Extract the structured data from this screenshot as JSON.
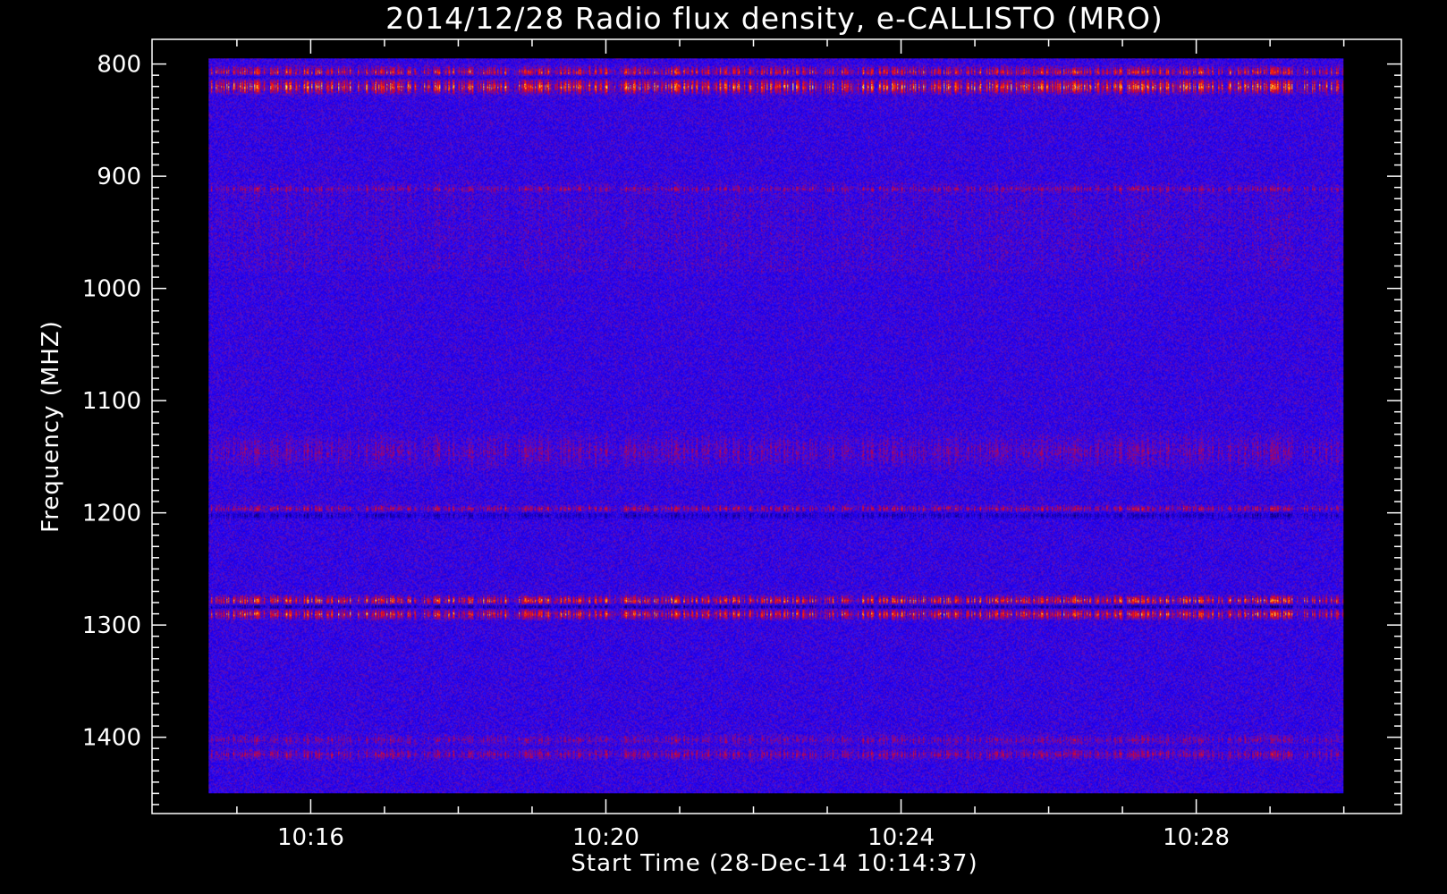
{
  "chart_data": {
    "type": "heatmap",
    "title": "2014/12/28  Radio flux density, e-CALLISTO (MRO)",
    "xlabel": "Start Time (28-Dec-14 10:14:37)",
    "ylabel": "Frequency (MHZ)",
    "x_ticks": [
      "10:16",
      "10:20",
      "10:24",
      "10:28"
    ],
    "x_tick_minutes": [
      16,
      20,
      24,
      28
    ],
    "x_range_minutes": [
      14.617,
      30.0
    ],
    "xlim_minutes": [
      13.85,
      30.78
    ],
    "y_ticks": [
      800,
      900,
      1000,
      1100,
      1200,
      1300,
      1400
    ],
    "y_range_mhz": [
      795,
      1450
    ],
    "ylim_mhz": [
      778,
      1468
    ],
    "y_inverted": true,
    "grid": false,
    "colormap": [
      "#000000",
      "#1a00c8",
      "#2020ff",
      "#a01030",
      "#ff2000",
      "#ff9000",
      "#ffff60"
    ],
    "background_color": "#2424ff",
    "emission_bands": [
      {
        "center_mhz": 808,
        "width_mhz": 8,
        "intensity": 0.8,
        "note": "red/orange band"
      },
      {
        "center_mhz": 820,
        "width_mhz": 8,
        "intensity": 0.95,
        "note": "yellow band"
      },
      {
        "center_mhz": 811,
        "width_mhz": 4,
        "intensity": -0.7,
        "note": "dark band"
      },
      {
        "center_mhz": 911,
        "width_mhz": 3,
        "intensity": 0.35
      },
      {
        "center_mhz": 1145,
        "width_mhz": 20,
        "intensity": 0.25
      },
      {
        "center_mhz": 1196,
        "width_mhz": 4,
        "intensity": 0.5
      },
      {
        "center_mhz": 1202,
        "width_mhz": 4,
        "intensity": -0.5
      },
      {
        "center_mhz": 1278,
        "width_mhz": 6,
        "intensity": 0.85
      },
      {
        "center_mhz": 1283,
        "width_mhz": 3,
        "intensity": -0.8
      },
      {
        "center_mhz": 1290,
        "width_mhz": 6,
        "intensity": 0.8
      },
      {
        "center_mhz": 1402,
        "width_mhz": 6,
        "intensity": 0.3
      },
      {
        "center_mhz": 1415,
        "width_mhz": 6,
        "intensity": 0.4
      }
    ]
  }
}
